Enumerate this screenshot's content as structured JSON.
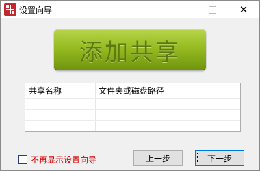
{
  "window": {
    "title": "设置向导",
    "close_symbol": "✕"
  },
  "add_share": {
    "label": "添加共享"
  },
  "share_table": {
    "columns": [
      "共享名称",
      "文件夹或磁盘路径"
    ],
    "rows": []
  },
  "option": {
    "checkbox_label": "不再显示设置向导",
    "checked": false
  },
  "buttons": {
    "prev": "上一步",
    "next": "下一步"
  }
}
